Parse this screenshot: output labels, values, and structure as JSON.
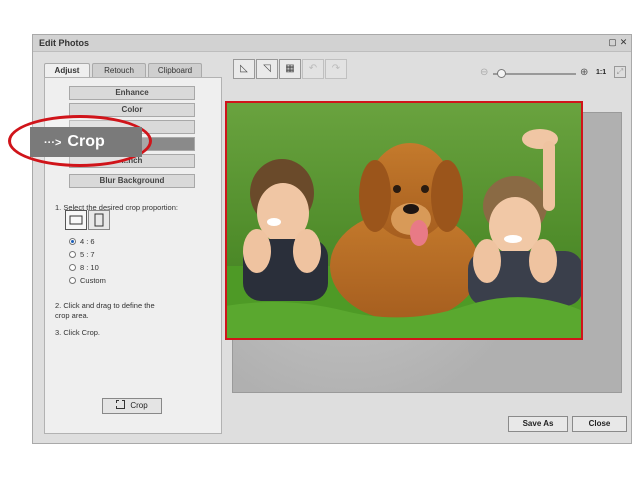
{
  "window": {
    "title": "Edit Photos"
  },
  "tabs": [
    {
      "label": "Adjust",
      "active": true
    },
    {
      "label": "Retouch",
      "active": false
    },
    {
      "label": "Clipboard",
      "active": false
    }
  ],
  "menu": {
    "items": [
      {
        "label": "Enhance"
      },
      {
        "label": "Color"
      },
      {
        "label": ""
      },
      {
        "label": ""
      },
      {
        "label": "...nch"
      },
      {
        "label": "Blur Background"
      }
    ]
  },
  "callout": {
    "arrow": "···>",
    "label": "Crop"
  },
  "instructions": {
    "step1": "1. Select the desired crop proportion:",
    "step2_line1": "2. Click and drag to define the",
    "step2_line2": "crop area.",
    "step3": "3. Click Crop."
  },
  "proportions": [
    {
      "label": "4 : 6",
      "checked": true
    },
    {
      "label": "5 : 7",
      "checked": false
    },
    {
      "label": "8 : 10",
      "checked": false
    },
    {
      "label": "Custom",
      "checked": false
    }
  ],
  "crop_button": {
    "label": "Crop"
  },
  "zoom": {
    "label": "1:1",
    "level_fraction": 0.1
  },
  "buttons": {
    "save_as": "Save As",
    "close": "Close"
  },
  "colors": {
    "crop_frame": "#d0141a",
    "highlight": "#d0141a"
  }
}
